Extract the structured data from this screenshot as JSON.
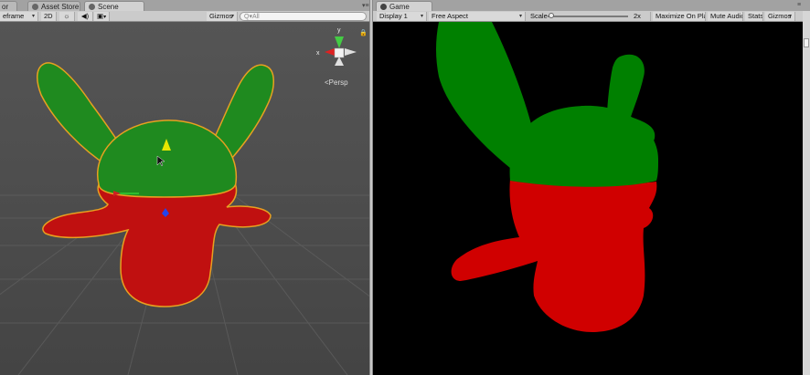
{
  "scene_tabs": [
    {
      "label": "or"
    },
    {
      "label": "Asset Store"
    },
    {
      "label": "Scene"
    }
  ],
  "game_tab": {
    "label": "Game"
  },
  "scene_toolbar": {
    "shading_mode": "eframe",
    "mode_2d": "2D",
    "gizmos": "Gizmos",
    "search_placeholder": "Q▾All"
  },
  "game_toolbar": {
    "display": "Display 1",
    "aspect": "Free Aspect",
    "scale_label": "Scale",
    "scale_value": "2x",
    "scale_fraction": 0.05,
    "maximize_on_play": "Maximize On Play",
    "mute_audio": "Mute Audio",
    "stats": "Stats",
    "gizmos": "Gizmos"
  },
  "orientation_gizmo": {
    "x_label": "x",
    "y_label": "y",
    "projection_label": "Persp"
  },
  "colors": {
    "editor_chrome": "#cbcbcb",
    "scene_background": "#4c4c4c",
    "game_background": "#000000",
    "model_top": "#1f8a1f",
    "model_bottom": "#c01010",
    "game_top": "#008000",
    "game_bottom": "#d00000",
    "selection_outline": "#e8a020"
  }
}
